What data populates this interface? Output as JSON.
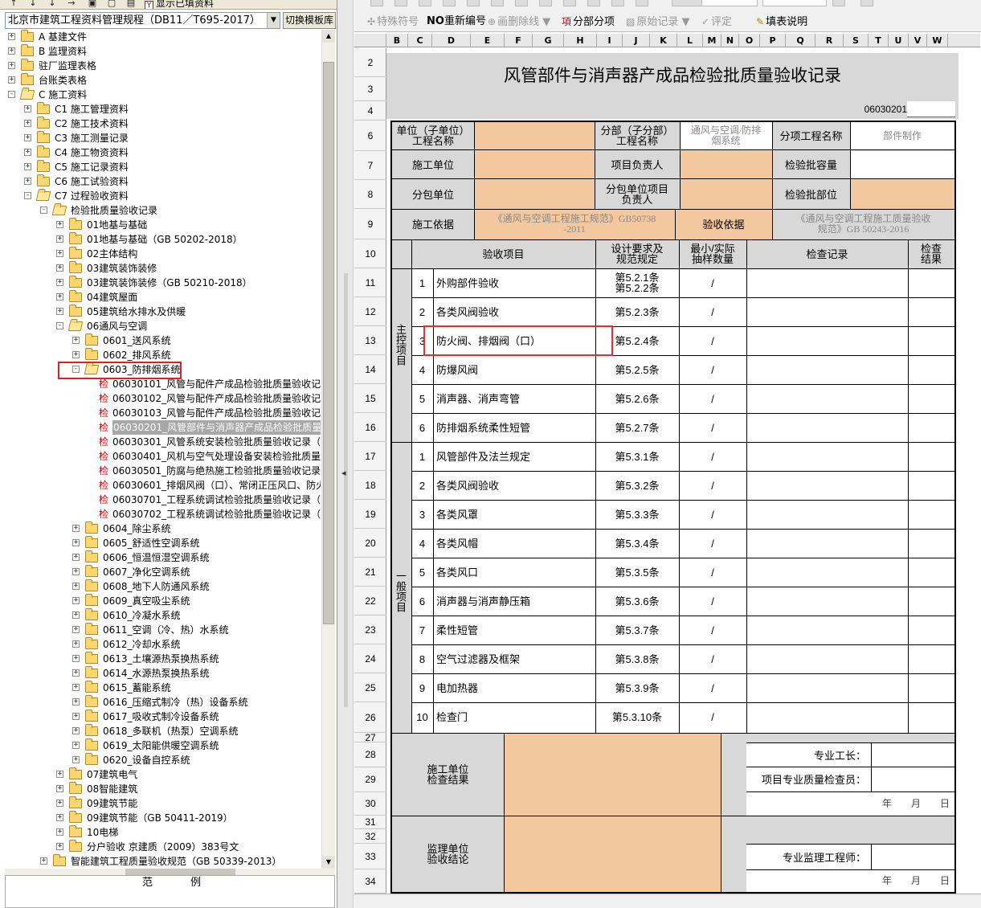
{
  "left": {
    "toolbar": {
      "show_filled": "显示已填资料"
    },
    "spec_select": "北京市建筑工程资料管理规程（DB11／T695-2017）",
    "switch_button": "切换模板库",
    "tree": [
      {
        "level": 0,
        "exp": "+",
        "folder": true,
        "open": false,
        "label": "A 基建文件"
      },
      {
        "level": 0,
        "exp": "+",
        "folder": true,
        "open": false,
        "label": "B 监理资料"
      },
      {
        "level": 0,
        "exp": "+",
        "folder": true,
        "open": false,
        "label": "驻厂监理表格"
      },
      {
        "level": 0,
        "exp": "+",
        "folder": true,
        "open": false,
        "label": "台账类表格"
      },
      {
        "level": 0,
        "exp": "-",
        "folder": true,
        "open": true,
        "label": "C 施工资料"
      },
      {
        "level": 1,
        "exp": "+",
        "folder": true,
        "open": false,
        "label": "C1 施工管理资料"
      },
      {
        "level": 1,
        "exp": "+",
        "folder": true,
        "open": false,
        "label": "C2 施工技术资料"
      },
      {
        "level": 1,
        "exp": "+",
        "folder": true,
        "open": false,
        "label": "C3 施工测量记录"
      },
      {
        "level": 1,
        "exp": "+",
        "folder": true,
        "open": false,
        "label": "C4 施工物资资料"
      },
      {
        "level": 1,
        "exp": "+",
        "folder": true,
        "open": false,
        "label": "C5 施工记录资料"
      },
      {
        "level": 1,
        "exp": "+",
        "folder": true,
        "open": false,
        "label": "C6 施工试验资料"
      },
      {
        "level": 1,
        "exp": "-",
        "folder": true,
        "open": true,
        "label": "C7 过程验收资料"
      },
      {
        "level": 2,
        "exp": "-",
        "folder": true,
        "open": true,
        "label": "检验批质量验收记录"
      },
      {
        "level": 3,
        "exp": "+",
        "folder": true,
        "open": false,
        "label": "01地基与基础"
      },
      {
        "level": 3,
        "exp": "+",
        "folder": true,
        "open": false,
        "label": "01地基与基础（GB 50202-2018）"
      },
      {
        "level": 3,
        "exp": "+",
        "folder": true,
        "open": false,
        "label": "02主体结构"
      },
      {
        "level": 3,
        "exp": "+",
        "folder": true,
        "open": false,
        "label": "03建筑装饰装修"
      },
      {
        "level": 3,
        "exp": "+",
        "folder": true,
        "open": false,
        "label": "03建筑装饰装修（GB 50210-2018）"
      },
      {
        "level": 3,
        "exp": "+",
        "folder": true,
        "open": false,
        "label": "04建筑屋面"
      },
      {
        "level": 3,
        "exp": "+",
        "folder": true,
        "open": false,
        "label": "05建筑给水排水及供暖"
      },
      {
        "level": 3,
        "exp": "-",
        "folder": true,
        "open": true,
        "label": "06通风与空调"
      },
      {
        "level": 4,
        "exp": "+",
        "folder": true,
        "open": false,
        "label": "0601_送风系统"
      },
      {
        "level": 4,
        "exp": "+",
        "folder": true,
        "open": false,
        "label": "0602_排风系统"
      },
      {
        "level": 4,
        "exp": "-",
        "folder": true,
        "open": true,
        "label": "0603_防排烟系统"
      },
      {
        "level": 5,
        "exp": "",
        "folder": false,
        "label": "06030101_风管与配件产成品检验批质量验收记录"
      },
      {
        "level": 5,
        "exp": "",
        "folder": false,
        "label": "06030102_风管与配件产成品检验批质量验收记录"
      },
      {
        "level": 5,
        "exp": "",
        "folder": false,
        "label": "06030103_风管与配件产成品检验批质量验收记录"
      },
      {
        "level": 5,
        "exp": "",
        "folder": false,
        "selected": true,
        "label": "06030201_风管部件与消声器产成品检验批质量验"
      },
      {
        "level": 5,
        "exp": "",
        "folder": false,
        "label": "06030301_风管系统安装检验批质量验收记录（防"
      },
      {
        "level": 5,
        "exp": "",
        "folder": false,
        "label": "06030401_风机与空气处理设备安装检验批质量验"
      },
      {
        "level": 5,
        "exp": "",
        "folder": false,
        "label": "06030501_防腐与绝热施工检验批质量验收记录（"
      },
      {
        "level": 5,
        "exp": "",
        "folder": false,
        "label": "06030601_排烟风阀（口）、常闭正压风口、防火"
      },
      {
        "level": 5,
        "exp": "",
        "folder": false,
        "label": "06030701_工程系统调试检验批质量验收记录（单"
      },
      {
        "level": 5,
        "exp": "",
        "folder": false,
        "label": "06030702_工程系统调试检验批质量验收记录（非"
      },
      {
        "level": 4,
        "exp": "+",
        "folder": true,
        "open": false,
        "label": "0604_除尘系统"
      },
      {
        "level": 4,
        "exp": "+",
        "folder": true,
        "open": false,
        "label": "0605_舒适性空调系统"
      },
      {
        "level": 4,
        "exp": "+",
        "folder": true,
        "open": false,
        "label": "0606_恒温恒湿空调系统"
      },
      {
        "level": 4,
        "exp": "+",
        "folder": true,
        "open": false,
        "label": "0607_净化空调系统"
      },
      {
        "level": 4,
        "exp": "+",
        "folder": true,
        "open": false,
        "label": "0608_地下人防通风系统"
      },
      {
        "level": 4,
        "exp": "+",
        "folder": true,
        "open": false,
        "label": "0609_真空吸尘系统"
      },
      {
        "level": 4,
        "exp": "+",
        "folder": true,
        "open": false,
        "label": "0610_冷凝水系统"
      },
      {
        "level": 4,
        "exp": "+",
        "folder": true,
        "open": false,
        "label": "0611_空调（冷、热）水系统"
      },
      {
        "level": 4,
        "exp": "+",
        "folder": true,
        "open": false,
        "label": "0612_冷却水系统"
      },
      {
        "level": 4,
        "exp": "+",
        "folder": true,
        "open": false,
        "label": "0613_土壤源热泵换热系统"
      },
      {
        "level": 4,
        "exp": "+",
        "folder": true,
        "open": false,
        "label": "0614_水源热泵换热系统"
      },
      {
        "level": 4,
        "exp": "+",
        "folder": true,
        "open": false,
        "label": "0615_蓄能系统"
      },
      {
        "level": 4,
        "exp": "+",
        "folder": true,
        "open": false,
        "label": "0616_压缩式制冷（热）设备系统"
      },
      {
        "level": 4,
        "exp": "+",
        "folder": true,
        "open": false,
        "label": "0617_吸收式制冷设备系统"
      },
      {
        "level": 4,
        "exp": "+",
        "folder": true,
        "open": false,
        "label": "0618_多联机（热泵）空调系统"
      },
      {
        "level": 4,
        "exp": "+",
        "folder": true,
        "open": false,
        "label": "0619_太阳能供暖空调系统"
      },
      {
        "level": 4,
        "exp": "+",
        "folder": true,
        "open": false,
        "label": "0620_设备自控系统"
      },
      {
        "level": 3,
        "exp": "+",
        "folder": true,
        "open": false,
        "label": "07建筑电气"
      },
      {
        "level": 3,
        "exp": "+",
        "folder": true,
        "open": false,
        "label": "08智能建筑"
      },
      {
        "level": 3,
        "exp": "+",
        "folder": true,
        "open": false,
        "label": "09建筑节能"
      },
      {
        "level": 3,
        "exp": "+",
        "folder": true,
        "open": false,
        "label": "09建筑节能（GB 50411-2019）"
      },
      {
        "level": 3,
        "exp": "+",
        "folder": true,
        "open": false,
        "label": "10电梯"
      },
      {
        "level": 3,
        "exp": "+",
        "folder": true,
        "open": false,
        "label": "分户验收 京建质（2009）383号文"
      },
      {
        "level": 2,
        "exp": "+",
        "folder": true,
        "open": false,
        "label": "智能建筑工程质量验收规范（GB 50339-2013）"
      }
    ],
    "jian_char": "检",
    "legend": {
      "fan": "范",
      "li": "例"
    }
  },
  "toolbar2": {
    "special_symbol": "特殊符号",
    "no_prefix": "NO",
    "renumber": "重新编号",
    "delete_line": "画删除线",
    "split_item": "分部分项",
    "original_record": "原始记录",
    "evaluate": "评定",
    "fill_help": "填表说明"
  },
  "columns": [
    "B",
    "C",
    "D",
    "E",
    "F",
    "G",
    "H",
    "I",
    "J",
    "K",
    "L",
    "M",
    "N",
    "O",
    "P",
    "Q",
    "R",
    "S",
    "T",
    "U",
    "V",
    "W"
  ],
  "rows": [
    "2",
    "3",
    "4",
    "6",
    "7",
    "8",
    "9",
    "10",
    "11",
    "12",
    "13",
    "14",
    "15",
    "16",
    "17",
    "18",
    "19",
    "20",
    "21",
    "22",
    "23",
    "24",
    "25",
    "26",
    "27",
    "28",
    "29",
    "30",
    "31",
    "32",
    "33",
    "34"
  ],
  "form": {
    "title": "风管部件与消声器产成品检验批质量验收记录",
    "doc_no": "06030201",
    "unit_project_name": "单位（子单位）\n工程名称",
    "sub_project_name": "分部（子分部）\n工程名称",
    "sub_project_value": "通风与空调/防排\n烟系统",
    "item_project_name": "分项工程名称",
    "item_project_value": "部件制作",
    "construction_unit": "施工单位",
    "project_manager": "项目负责人",
    "batch_capacity": "检验批容量",
    "subcontract_unit": "分包单位",
    "subcontract_manager": "分包单位项目\n负责人",
    "batch_location": "检验批部位",
    "construction_basis": "施工依据",
    "construction_basis_value": "《通风与空调工程施工规范》GB50738\n-2011",
    "acceptance_basis": "验收依据",
    "acceptance_basis_value": "《通风与空调工程施工质量验收\n规范》GB 50243-2016",
    "hdr_item": "验收项目",
    "hdr_design": "设计要求及\n规范规定",
    "hdr_sampling": "最小/实际\n抽样数量",
    "hdr_record": "检查记录",
    "hdr_result": "检查\n结果",
    "main_label": "主控项目",
    "general_label": "一般项目",
    "slash": "/",
    "main_items": [
      {
        "no": "1",
        "name": "外购部件验收",
        "clause": "第5.2.1条\n第5.2.2条"
      },
      {
        "no": "2",
        "name": "各类风阀验收",
        "clause": "第5.2.3条"
      },
      {
        "no": "3",
        "name": "防火阀、排烟阀（口）",
        "clause": "第5.2.4条"
      },
      {
        "no": "4",
        "name": "防爆风阀",
        "clause": "第5.2.5条"
      },
      {
        "no": "5",
        "name": "消声器、消声弯管",
        "clause": "第5.2.6条"
      },
      {
        "no": "6",
        "name": "防排烟系统柔性短管",
        "clause": "第5.2.7条"
      }
    ],
    "general_items": [
      {
        "no": "1",
        "name": "风管部件及法兰规定",
        "clause": "第5.3.1条"
      },
      {
        "no": "2",
        "name": "各类风阀验收",
        "clause": "第5.3.2条"
      },
      {
        "no": "3",
        "name": "各类风罩",
        "clause": "第5.3.3条"
      },
      {
        "no": "4",
        "name": "各类风帽",
        "clause": "第5.3.4条"
      },
      {
        "no": "5",
        "name": "各类风口",
        "clause": "第5.3.5条"
      },
      {
        "no": "6",
        "name": "消声器与消声静压箱",
        "clause": "第5.3.6条"
      },
      {
        "no": "7",
        "name": "柔性短管",
        "clause": "第5.3.7条"
      },
      {
        "no": "8",
        "name": "空气过滤器及框架",
        "clause": "第5.3.8条"
      },
      {
        "no": "9",
        "name": "电加热器",
        "clause": "第5.3.9条"
      },
      {
        "no": "10",
        "name": "检查门",
        "clause": "第5.3.10条"
      }
    ],
    "construction_result": "施工单位\n检查结果",
    "foreman": "专业工长：",
    "quality_inspector": "项目专业质量检查员：",
    "supervision_conclusion": "监理单位\n验收结论",
    "supervision_engineer": "专业监理工程师：",
    "date": "年　　月　　日"
  },
  "colors": {
    "peach": "#f4c89f",
    "gray": "#d8d8d8",
    "highlight": "#e02020"
  }
}
